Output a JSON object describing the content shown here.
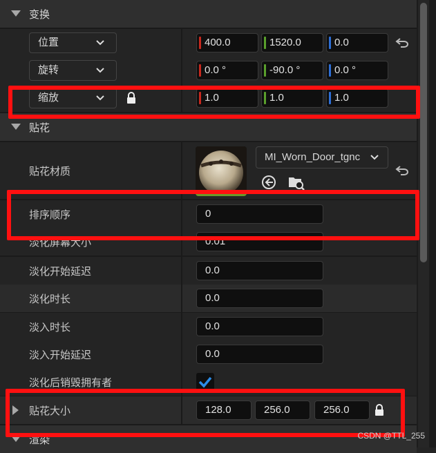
{
  "transform": {
    "section_title": "变换",
    "location": {
      "mode": "位置",
      "x": "400.0",
      "y": "1520.0",
      "z": "0.0"
    },
    "rotation": {
      "mode": "旋转",
      "x": "0.0 °",
      "y": "-90.0 °",
      "z": "0.0 °"
    },
    "scale": {
      "mode": "缩放",
      "x": "1.0",
      "y": "1.0",
      "z": "1.0"
    }
  },
  "decal": {
    "section_title": "贴花",
    "material": {
      "label": "贴花材质",
      "value": "MI_Worn_Door_tgnc"
    },
    "sort_order": {
      "label": "排序顺序",
      "value": "0"
    },
    "fade_screen_size": {
      "label": "淡化屏幕大小",
      "value": "0.01"
    },
    "fade_start_delay": {
      "label": "淡化开始延迟",
      "value": "0.0"
    },
    "fade_duration": {
      "label": "淡化时长",
      "value": "0.0"
    },
    "fade_in_duration": {
      "label": "淡入时长",
      "value": "0.0"
    },
    "fade_in_start_delay": {
      "label": "淡入开始延迟",
      "value": "0.0"
    },
    "destroy_owner_after_fade": {
      "label": "淡化后销毁拥有者",
      "checked": true
    },
    "decal_size": {
      "label": "贴花大小",
      "x": "128.0",
      "y": "256.0",
      "z": "256.0"
    }
  },
  "rendering": {
    "section_title": "渲染"
  },
  "watermark": "CSDN @TTL_255",
  "colors": {
    "x_axis": "#c8281e",
    "y_axis": "#5aa02c",
    "z_axis": "#2e6fd6",
    "highlight": "#ff1010",
    "check": "#2b8ce8"
  },
  "icons": [
    "reset-arrow-icon",
    "lock-icon",
    "chevron-down-icon",
    "use-selected-asset-icon",
    "browse-asset-icon",
    "checkmark-icon",
    "expand-triangle-icon"
  ]
}
